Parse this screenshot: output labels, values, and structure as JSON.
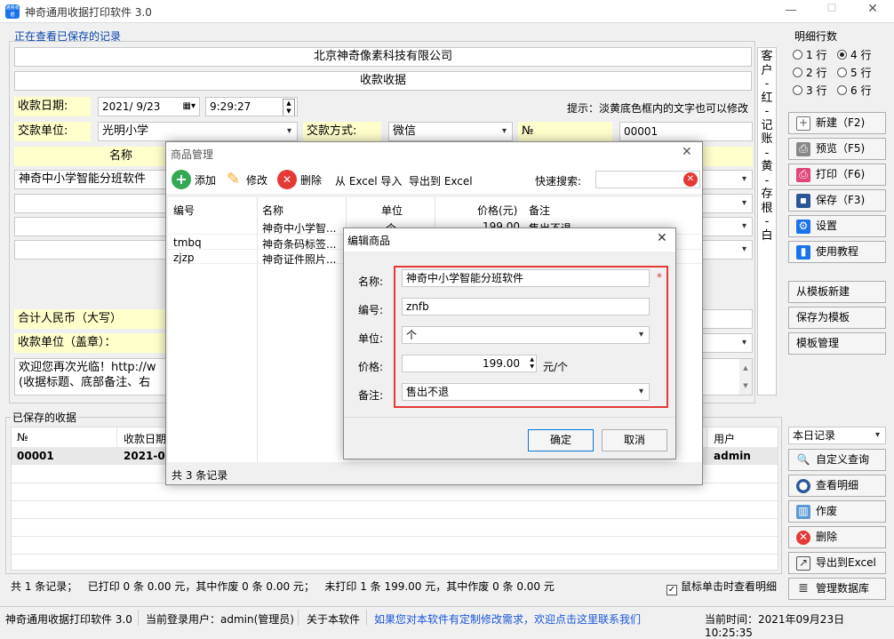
{
  "app": {
    "title": "神奇通用收据打印软件 3.0",
    "logo_text": "通用收据"
  },
  "header": {
    "viewing": "正在查看已保存的记录"
  },
  "receipt": {
    "company": "北京神奇像素科技有限公司",
    "doc_title": "款收据",
    "date_label": "收款日期:",
    "date": "2021/ 9/23",
    "time": "9:29:27",
    "hint": "提示：淡黄底色框内的文字也可以修改",
    "payer_label": "交款单位:",
    "payer": "光明小学",
    "method_label": "交款方式:",
    "method": "微信",
    "no_label": "№",
    "no": "00001",
    "col_name": "名称",
    "row1_name": "神奇中小学智能分班软件",
    "total_label": "合计人民币（大写）",
    "payee_label": "收款单位（盖章）：",
    "footer_l1": "欢迎您再次光临！http://w",
    "footer_l2": "(收据标题、底部备注、右"
  },
  "side_label": [
    "客",
    "户",
    "-",
    "红",
    "-",
    "记",
    "账",
    "-",
    "黄",
    "-",
    "存",
    "根",
    "-",
    "白"
  ],
  "rows_box": {
    "title": "明细行数",
    "opts": [
      "1 行",
      "4 行",
      "2 行",
      "5 行",
      "3 行",
      "6 行"
    ]
  },
  "right_buttons": {
    "new": "新建（F2)",
    "preview": "预览（F5)",
    "print": "打印（F6)",
    "save": "保存（F3)",
    "settings": "设置",
    "tutorial": "使用教程",
    "from_tpl": "从模板新建",
    "save_tpl": "保存为模板",
    "tpl_mgr": "模板管理"
  },
  "saved": {
    "title": "已保存的收据",
    "col_no": "№",
    "col_date": "收款日期",
    "col_user": "用户",
    "row_no": "00001",
    "row_date": "2021-09",
    "row_user": "admin",
    "summary": "共 1 条记录；   已打印 0 条 0.00 元，其中作废 0 条 0.00 元；   未打印 1 条 199.00 元，其中作废 0 条 0.00 元",
    "click_toggle": "鼠标单击时查看明细"
  },
  "saved_buttons": {
    "filter": "本日记录",
    "query": "自定义查询",
    "detail": "查看明细",
    "void": "作废",
    "delete": "删除",
    "export": "导出到Excel",
    "db": "管理数据库"
  },
  "status": {
    "app": "神奇通用收据打印软件 3.0",
    "user": "当前登录用户：admin(管理员)",
    "about": "关于本软件",
    "link": "如果您对本软件有定制修改需求，欢迎点击这里联系我们",
    "time": "当前时间：2021年09月23日 10:25:35"
  },
  "goods": {
    "title": "商品管理",
    "add": "添加",
    "edit": "修改",
    "delete": "删除",
    "import": "从 Excel 导入",
    "export": "导出到 Excel",
    "search_label": "快速搜索:",
    "headers": [
      "编号",
      "名称",
      "单位",
      "价格(元)",
      "备注"
    ],
    "rows": [
      {
        "code": "",
        "name": "神奇中小学智...",
        "unit": "个",
        "price": "199.00",
        "note": "售出不退"
      },
      {
        "code": "tmbq",
        "name": "神奇条码标签...",
        "unit": "",
        "price": "",
        "note": ""
      },
      {
        "code": "zjzp",
        "name": "神奇证件照片...",
        "unit": "",
        "price": "",
        "note": ""
      }
    ],
    "count": "共 3 条记录"
  },
  "edit": {
    "title": "编辑商品",
    "name_label": "名称:",
    "name": "神奇中小学智能分班软件",
    "required": "*",
    "code_label": "编号:",
    "code": "znfb",
    "unit_label": "单位:",
    "unit": "个",
    "price_label": "价格:",
    "price": "199.00",
    "price_unit": "元/个",
    "note_label": "备注:",
    "note": "售出不退",
    "ok": "确定",
    "cancel": "取消"
  },
  "colors": {
    "accent": "#1a73e8",
    "highlight_border": "#e53935",
    "yellow": "#ffffcc"
  }
}
